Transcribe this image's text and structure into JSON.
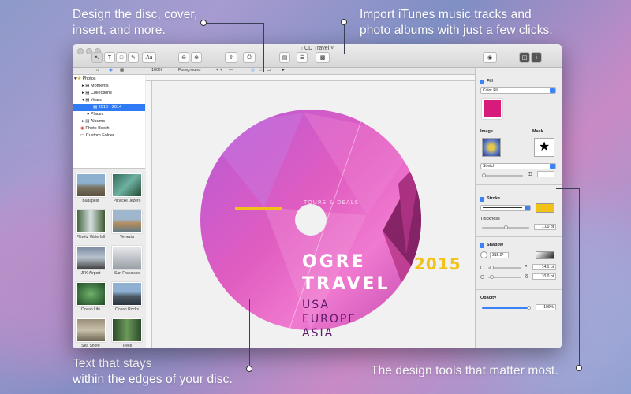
{
  "captions": {
    "design_line1": "Design the disc, cover,",
    "design_line2": "insert, and more.",
    "import_line1": "Import iTunes music tracks and",
    "import_line2": "photo albums with just a few clicks.",
    "text_line1": "Text that stays",
    "text_line2": "within the edges of your disc.",
    "tools": "The design tools that matter most."
  },
  "window": {
    "title": "CD Travel",
    "zoom": "100%",
    "layer": "Foreground"
  },
  "tree": [
    {
      "label": "Photos",
      "level": 0
    },
    {
      "label": "Moments",
      "level": 1
    },
    {
      "label": "Collections",
      "level": 1
    },
    {
      "label": "Years",
      "level": 1
    },
    {
      "label": "2010 - 2014",
      "level": 2,
      "selected": true
    },
    {
      "label": "Places",
      "level": 1
    },
    {
      "label": "Albums",
      "level": 1
    },
    {
      "label": "Photo Booth",
      "level": 0
    },
    {
      "label": "Custom Folder",
      "level": 0
    }
  ],
  "thumbnails": [
    "Budapest",
    "Plitvicke Jezero",
    "Plitwitz Waterfall",
    "Venezia",
    "JFK Airport",
    "San Francisco",
    "Ocean Life",
    "Ocean Rocks",
    "Sea Shore",
    "Trees"
  ],
  "disc": {
    "tagline": "TOURS & DEALS",
    "title1": "OGRE",
    "title2": "TRAVEL",
    "year": "2015",
    "dest1": "USA",
    "dest2": "EUROPE",
    "dest3": "ASIA"
  },
  "inspector": {
    "fill_label": "Fill",
    "fill_type": "Color Fill",
    "fill_color": "#d81b7a",
    "image_label": "Image",
    "mask_label": "Mask",
    "stretch": "Stretch",
    "stroke_label": "Stroke",
    "stroke_color": "#f2c21a",
    "thickness_label": "Thickness",
    "thickness_value": "1.00 pt",
    "shadow_label": "Shadow",
    "shadow_angle": "315.0°",
    "shadow_offset": "14.1 pt",
    "shadow_blur": "10.0 pt",
    "opacity_label": "Opacity",
    "opacity_value": "100%"
  },
  "colors": {
    "accent": "#3b82f6",
    "disc_pink": "#e15cc0",
    "year_yellow": "#f2c21a"
  }
}
